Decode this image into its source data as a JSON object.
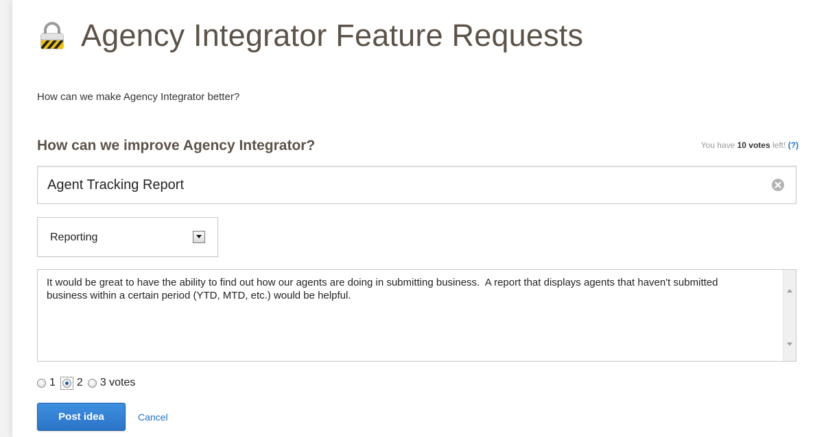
{
  "page": {
    "title": "Agency Integrator Feature Requests",
    "subtitle": "How can we make Agency Integrator better?"
  },
  "form": {
    "heading": "How can we improve Agency Integrator?",
    "votes_prefix": "You have",
    "votes_count": "10 votes",
    "votes_suffix": "left!",
    "votes_help": "(?)",
    "idea_title": "Agent Tracking Report",
    "category": "Reporting",
    "description": "It would be great to have the ability to find out how our agents are doing in submitting business.  A report that displays agents that haven't submitted business within a certain period (YTD, MTD, etc.) would be helpful.",
    "vote_options": [
      "1",
      "2",
      "3 votes"
    ],
    "selected_votes": "2",
    "post_label": "Post idea",
    "cancel_label": "Cancel"
  },
  "icons": {
    "title_icon": "lock-icon",
    "clear_icon": "clear-icon",
    "select_icon": "chevron-down-icon"
  },
  "colors": {
    "title": "#5c5248",
    "link": "#1a73c8",
    "button": "#2b74c8"
  }
}
